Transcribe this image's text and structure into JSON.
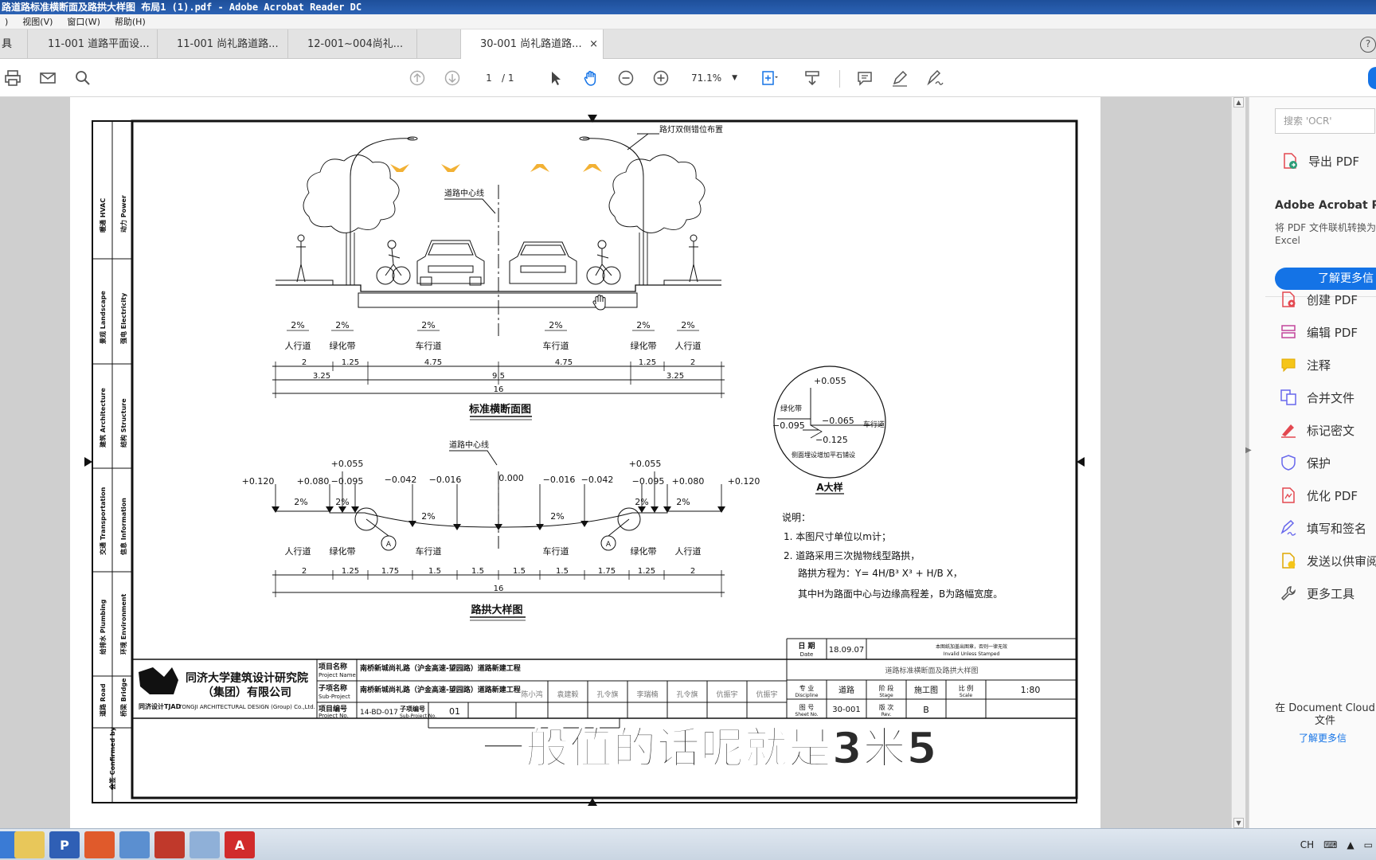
{
  "window": {
    "title": "路道路标准横断面及路拱大样图 布局1 (1).pdf - Adobe Acrobat Reader DC"
  },
  "menu": {
    "items": [
      ")",
      "视图(V)",
      "窗口(W)",
      "帮助(H)"
    ]
  },
  "tabs": {
    "stub": "具",
    "items": [
      {
        "label": "11-001 道路平面设..."
      },
      {
        "label": "11-001 尚礼路道路..."
      },
      {
        "label": "12-001~004尚礼..."
      },
      {
        "label": "30-001 尚礼路道路..."
      }
    ],
    "close_glyph": "×",
    "help_glyph": "?"
  },
  "toolbar": {
    "page_current": "1",
    "page_total": "/ 1",
    "zoom": "71.1%"
  },
  "drawing": {
    "leader_lamp": "路灯双侧错位布置",
    "leader_centerline": "道路中心线",
    "slopes_top": [
      "2%",
      "2%",
      "2%",
      "2%",
      "2%",
      "2%"
    ],
    "zones_top": [
      "人行道",
      "绿化带",
      "车行道",
      "车行道",
      "绿化带",
      "人行道"
    ],
    "dims_top_row1": [
      "2",
      "1.25",
      "4.75",
      "4.75",
      "1.25",
      "2"
    ],
    "dims_top_row2": [
      "3.25",
      "9.5",
      "3.25"
    ],
    "dims_top_total": "16",
    "title_cross_section": "标准横断面图",
    "leader_centerline_2": "道路中心线",
    "elev_labels": [
      "+0.120",
      "+0.080",
      "+0.055",
      "−0.095",
      "−0.042",
      "−0.016",
      "0.000",
      "−0.016",
      "−0.042",
      "+0.055",
      "−0.095",
      "+0.080",
      "+0.120"
    ],
    "slopes_bottom": [
      "2%",
      "2%",
      "2%",
      "2%",
      "2%",
      "2%"
    ],
    "zones_bottom": [
      "人行道",
      "绿化带",
      "车行道",
      "车行道",
      "绿化带",
      "人行道"
    ],
    "marker_a": "A",
    "dims_bottom": [
      "2",
      "1.25",
      "1.75",
      "1.5",
      "1.5",
      "1.5",
      "1.5",
      "1.75",
      "1.25",
      "2"
    ],
    "dims_bottom_total": "16",
    "title_crown": "路拱大样图",
    "detail": {
      "green": "绿化带",
      "road": "车行道",
      "e1": "+0.055",
      "e2": "−0.065",
      "e3": "−0.095",
      "e4": "−0.125",
      "note": "侧面埋设增加平石铺设",
      "title": "A大样"
    },
    "notes": {
      "heading": "说明：",
      "n1": "1.  本图尺寸单位以m计；",
      "n2": "2.  道路采用三次抛物线型路拱，",
      "n3": "路拱方程为：Y= 4H/B³ X³ + H/B X，",
      "n4": "其中H为路面中心与边缘高程差，B为路幅宽度。"
    },
    "sidebar_labels": [
      "暖通 HVAC",
      "动力 Power",
      "景观 Landscape",
      "强电 Electricity",
      "建筑 Architecture",
      "结构 Structure",
      "交通 Transportation",
      "信息 Information",
      "给排水 Plumbing",
      "环境 Environment",
      "道路 Road",
      "桥梁 Bridge",
      "会签 Confirmed by"
    ],
    "titleblock": {
      "company_cn1": "同济大学建筑设计研究院",
      "company_cn2": "（集团）有限公司",
      "company_en": "TONGJI ARCHITECTURAL DESIGN (Group) Co.,Ltd.",
      "logo_text": "同济设计TJAD",
      "project_label": "项目名称",
      "project_label_en": "Project Name",
      "project_value": "南桥新城尚礼路（沪金高速-望园路）道路新建工程",
      "sub_label": "子项名称",
      "sub_label_en": "Sub-Project",
      "sub_value": "南桥新城尚礼路（沪金高速-望园路）道路新建工程",
      "projno_label": "项目编号",
      "projno_label_en": "Project No.",
      "projno_value": "14-BD-017",
      "subno_label": "子项编号",
      "subno_label_en": "Sub-Project No.",
      "subno_value": "01",
      "date_label": "日 期",
      "date_label_en": "Date",
      "date_value": "18.09.07",
      "stamp_note": "本图纸加盖出图章，否则一律无效",
      "stamp_note_en": "Invalid Unless Stamped",
      "drawing_title": "道路标准横断面及路拱大样图",
      "names": [
        "陈小鸿",
        "袁建毅",
        "孔令旗",
        "李瑞楠",
        "孔令旗",
        "伉振宇",
        "伉振宇"
      ],
      "discipline_label": "专 业",
      "discipline_label_en": "Discipline",
      "discipline_value": "道路",
      "stage_label": "阶 段",
      "stage_label_en": "Stage",
      "stage_value": "施工图",
      "scale_label": "比 例",
      "scale_label_en": "Scale",
      "scale_value": "1:80",
      "sheet_label": "图 号",
      "sheet_label_en": "Sheet No.",
      "sheet_value": "30-001",
      "rev_label": "版 次",
      "rev_label_en": "Rev.",
      "rev_value": "B"
    }
  },
  "subtitle": "一般值的话呢就是3米5",
  "right_panel": {
    "search_placeholder": "搜索 'OCR'",
    "export_pdf": "导出 PDF",
    "promo_title": "Adobe Acrobat Pro",
    "promo_desc1": "将 PDF 文件联机转换为",
    "promo_desc2": "Excel",
    "promo_button": "了解更多信",
    "tools": [
      "创建 PDF",
      "编辑 PDF",
      "注释",
      "合并文件",
      "标记密文",
      "保护",
      "优化 PDF",
      "填写和签名",
      "发送以供审阅",
      "更多工具"
    ],
    "cloud_text1": "在 Document Cloud",
    "cloud_text2": "文件",
    "cloud_more": "了解更多信"
  },
  "taskbar": {
    "lang": "CH"
  }
}
